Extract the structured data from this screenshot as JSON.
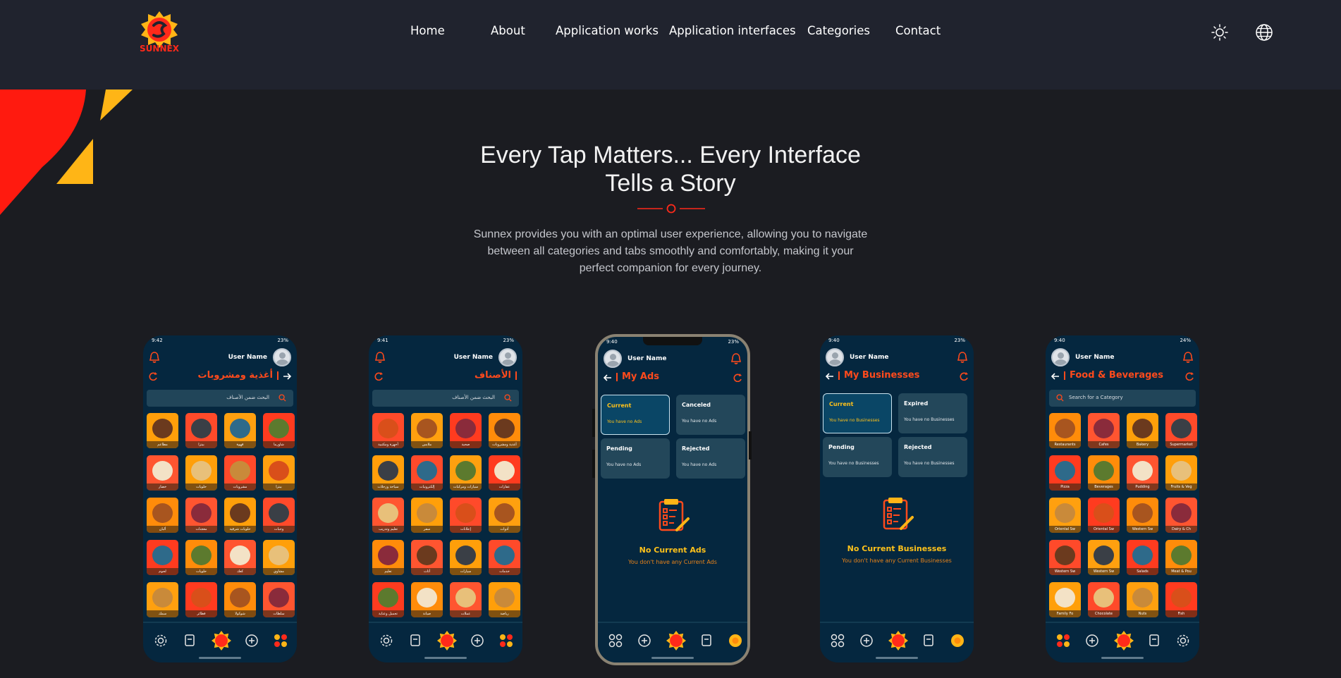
{
  "header": {
    "brand": "SUNNEX",
    "nav": [
      "Home",
      "About",
      "Application works",
      "Application interfaces",
      "Categories",
      "Contact"
    ],
    "icons": [
      "theme-sun-icon",
      "language-globe-icon"
    ]
  },
  "hero": {
    "title_line1": "Every Tap Matters... Every Interface",
    "title_line2": "Tells a Story",
    "description_line1": "Sunnex provides you with an optimal user experience, allowing you to navigate",
    "description_line2": "between all categories and tabs smoothly and comfortably, making it your",
    "description_line3": "perfect companion for every journey."
  },
  "colors": {
    "accent_red": "#ff2a1a",
    "accent_yellow": "#ffb516",
    "phone_bg": "#05273f",
    "page_bg": "#1b1c21",
    "header_bg": "#20232e"
  },
  "phones": [
    {
      "time": "9:42",
      "battery": "23%",
      "user_name": "User Name",
      "title": "أغذية ومشروبات",
      "search_placeholder": "البحث ضمن الأصناف",
      "tiles": [
        "مطاعم",
        "بيتزا",
        "قهوة",
        "شاورما",
        "خضار",
        "حلويات",
        "مشروبات",
        "بيتزا",
        "ألبان",
        "معجنات",
        "حلويات شرقية",
        "وجبات",
        "لحوم",
        "حلويات",
        "كعك",
        "مشاوي",
        "سمك",
        "فطائر",
        "شوكولا",
        "سلطات"
      ]
    },
    {
      "time": "9:41",
      "battery": "23%",
      "user_name": "User Name",
      "title": "الأصناف",
      "search_placeholder": "البحث ضمن الأصناف",
      "tiles": [
        "أجهزة ومكتبية",
        "ملابس",
        "صحية",
        "أغذية ومشروبات",
        "سياحة ورحلات",
        "إلكترونيات",
        "سيارات ومركبات",
        "عقارات",
        "تعليم وتدريب",
        "سفر",
        "إعلانات",
        "أدوات",
        "تعليم",
        "أثاث",
        "سيارات",
        "خدمات",
        "تجميل وعناية",
        "صيانة",
        "عملات",
        "رياضة"
      ]
    },
    {
      "time": "9:40",
      "battery": "23%",
      "user_name": "User Name",
      "title": "My Ads",
      "cards": [
        {
          "title": "Current",
          "sub": "You have no Ads"
        },
        {
          "title": "Canceled",
          "sub": "You have no Ads"
        },
        {
          "title": "Pending",
          "sub": "You have no Ads"
        },
        {
          "title": "Rejected",
          "sub": "You have no Ads"
        }
      ],
      "empty_title": "No Current Ads",
      "empty_sub": "You don't have any Current Ads"
    },
    {
      "time": "9:40",
      "battery": "23%",
      "user_name": "User Name",
      "title": "My Businesses",
      "cards": [
        {
          "title": "Current",
          "sub": "You have no Businesses"
        },
        {
          "title": "Expired",
          "sub": "You have no Businesses"
        },
        {
          "title": "Pending",
          "sub": "You have no Businesses"
        },
        {
          "title": "Rejected",
          "sub": "You have no Businesses"
        }
      ],
      "empty_title": "No Current Businesses",
      "empty_sub": "You don't have any Current Businesses"
    },
    {
      "time": "9:40",
      "battery": "24%",
      "user_name": "User Name",
      "title": "Food & Beverages",
      "search_placeholder": "Search for a Category",
      "tiles": [
        "Restaurants",
        "Cafes",
        "Bakery",
        "Supermarket",
        "Pizza",
        "Beverages",
        "Pudding",
        "Fruits & Veg",
        "Oriental Sw",
        "Oriental Sw",
        "Western Sw",
        "Dairy & Ch",
        "Western Sw",
        "Western Sw",
        "Salads",
        "Meat & Pou",
        "Family Fo",
        "Chocolate",
        "Nuts",
        "Fish"
      ]
    }
  ]
}
